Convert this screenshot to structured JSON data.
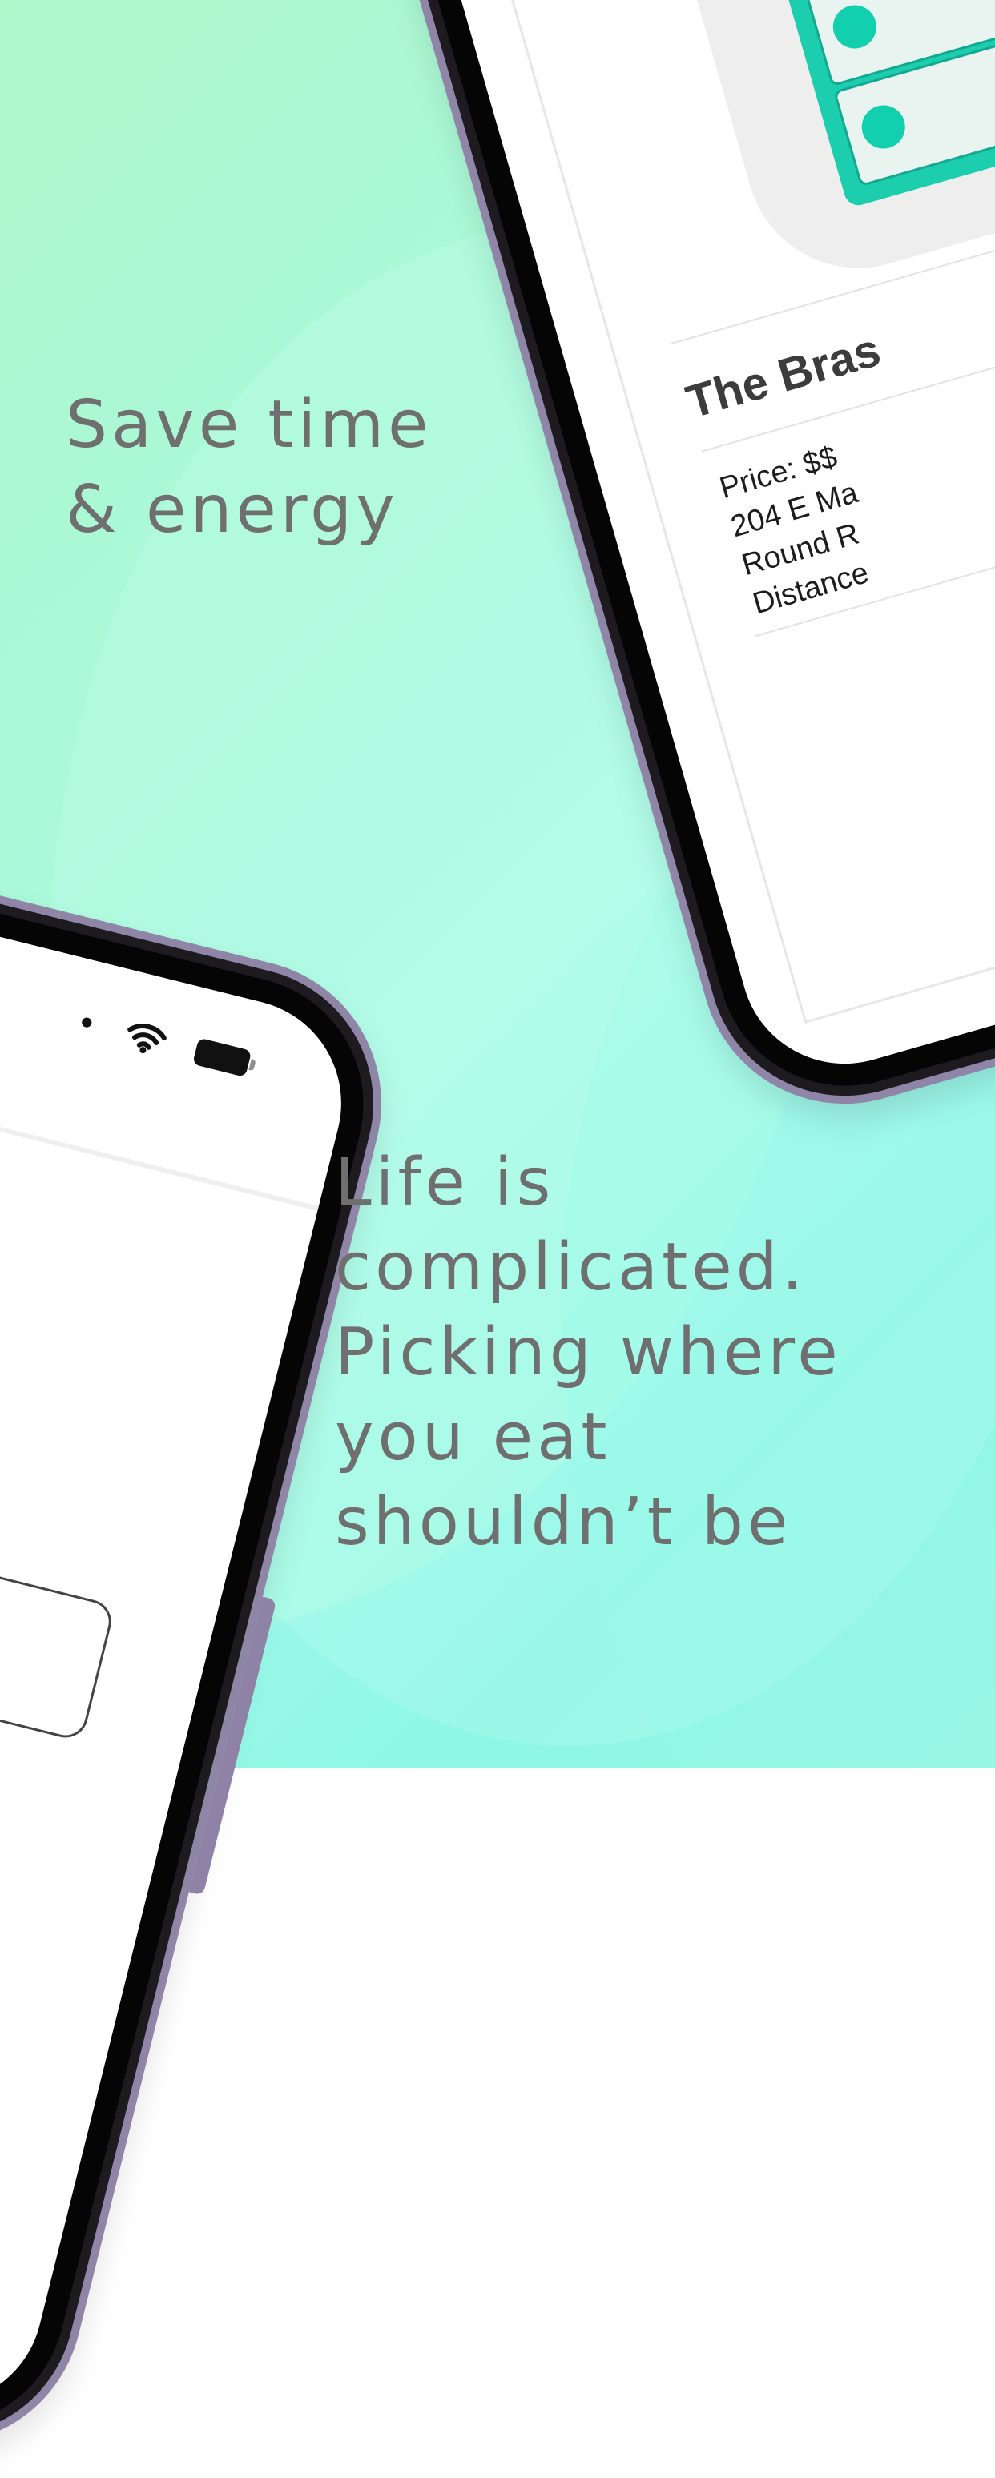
{
  "headlines": {
    "primary": [
      "Save time",
      "& energy"
    ],
    "secondary": [
      "Life is",
      "complicated.",
      "Picking where",
      "you eat",
      "shouldn’t be"
    ]
  },
  "restaurant_card": {
    "title": "The Bras",
    "details": [
      "Price: $$",
      "204 E Ma",
      "Round R",
      "Distance"
    ]
  },
  "status_bar": {
    "signal": "•"
  },
  "colors": {
    "background_start": "#a8f5c6",
    "background_end": "#8ef7e6",
    "headline_text": "#6f6f6f",
    "brand_teal": "#1ccdae",
    "dark_card": "#2b3a42",
    "phone_frame": "#8f85a6"
  },
  "icons": {
    "wifi": "wifi-icon",
    "battery": "battery-icon",
    "check": "check-icon"
  }
}
